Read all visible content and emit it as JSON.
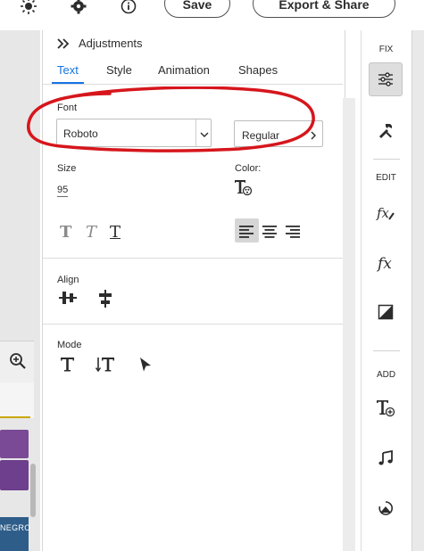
{
  "toolbar": {
    "save_label": "Save",
    "export_label": "Export & Share"
  },
  "panel": {
    "title": "Adjustments",
    "collapse_icon": "double-chevron-right-icon",
    "tabs": [
      {
        "label": "Text",
        "active": true
      },
      {
        "label": "Style",
        "active": false
      },
      {
        "label": "Animation",
        "active": false
      },
      {
        "label": "Shapes",
        "active": false
      }
    ],
    "font": {
      "label": "Font",
      "family_value": "Roboto",
      "weight_value": "Regular"
    },
    "size": {
      "label": "Size",
      "value": "95"
    },
    "color": {
      "label": "Color:"
    },
    "align_section": {
      "label": "Align"
    },
    "mode_section": {
      "label": "Mode"
    }
  },
  "rail": {
    "fix_label": "FIX",
    "edit_label": "EDIT",
    "add_label": "ADD"
  },
  "timeline": {
    "clip_text": "NEGRO"
  },
  "colors": {
    "accent": "#1473e6",
    "annotation": "#d6161c",
    "timeline_purple": "#7a4a96",
    "timeline_blue": "#2f5d8a"
  }
}
